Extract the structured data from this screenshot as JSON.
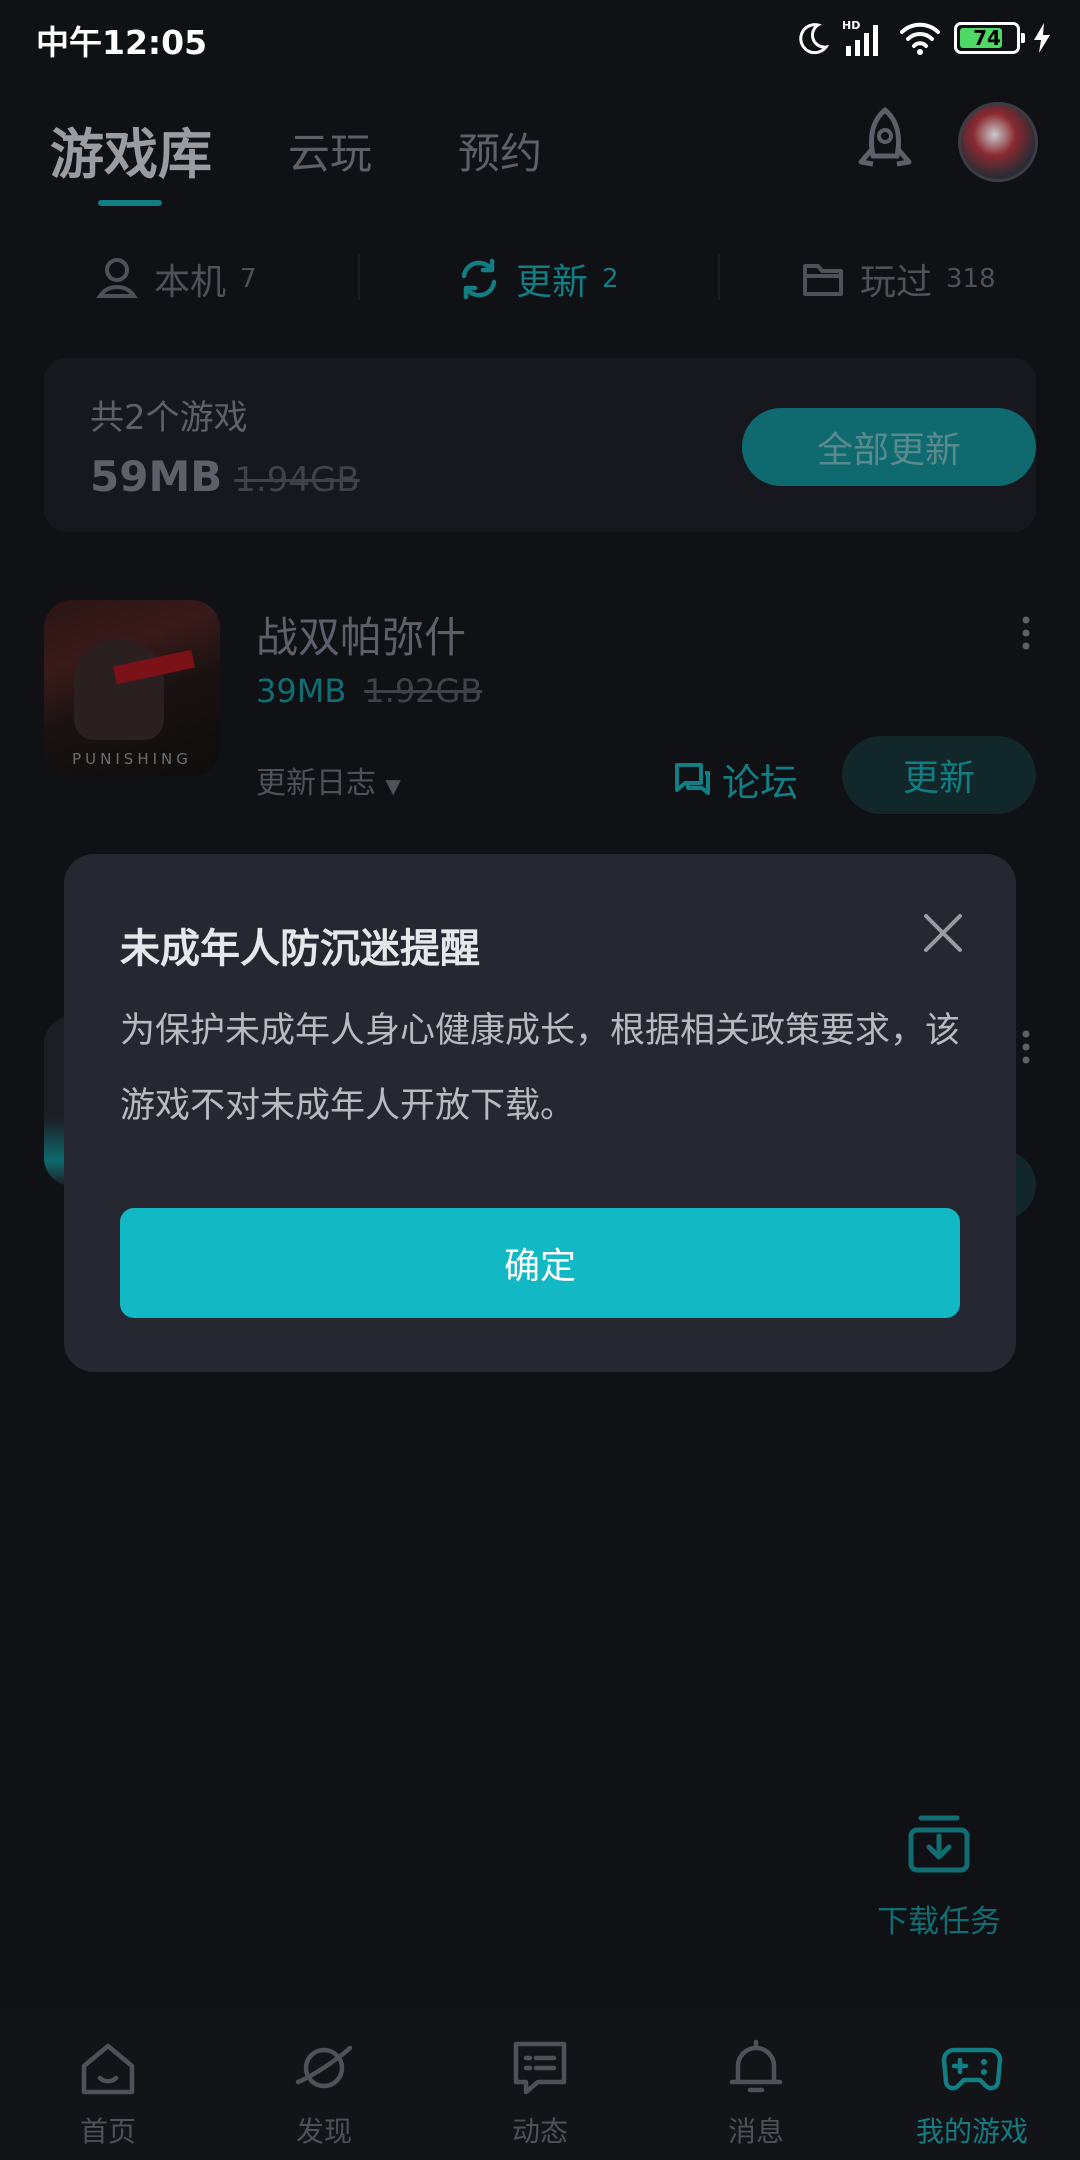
{
  "status_bar": {
    "time": "中午12:05",
    "battery": "74",
    "network": "HD"
  },
  "header": {
    "tabs": [
      {
        "label": "游戏库",
        "active": true
      },
      {
        "label": "云玩",
        "active": false
      },
      {
        "label": "预约",
        "active": false
      }
    ]
  },
  "sub_tabs": [
    {
      "label": "本机",
      "count": "7",
      "icon": "device-icon"
    },
    {
      "label": "更新",
      "count": "2",
      "icon": "refresh-icon",
      "active": true
    },
    {
      "label": "玩过",
      "count": "318",
      "icon": "folder-icon"
    }
  ],
  "summary": {
    "count_text": "共2个游戏",
    "size": "59MB",
    "original_size": "1.94GB",
    "update_all_label": "全部更新"
  },
  "game": {
    "name": "战双帕弥什",
    "size": "39MB",
    "original_size": "1.92GB",
    "changelog_label": "更新日志",
    "forum_label": "论坛",
    "update_label": "更新",
    "icon_watermark": "PUNISHING"
  },
  "modal": {
    "title": "未成年人防沉迷提醒",
    "message": "为保护未成年人身心健康成长，根据相关政策要求，该游戏不对未成年人开放下载。",
    "confirm_label": "确定"
  },
  "download_task": {
    "label": "下载任务"
  },
  "bottom_nav": [
    {
      "label": "首页",
      "icon": "home-icon"
    },
    {
      "label": "发现",
      "icon": "planet-icon"
    },
    {
      "label": "动态",
      "icon": "chat-icon"
    },
    {
      "label": "消息",
      "icon": "bell-icon"
    },
    {
      "label": "我的游戏",
      "icon": "gamepad-icon",
      "active": true
    }
  ],
  "colors": {
    "accent": "#13b8c5",
    "background": "#0f1115",
    "modal": "#262831"
  }
}
